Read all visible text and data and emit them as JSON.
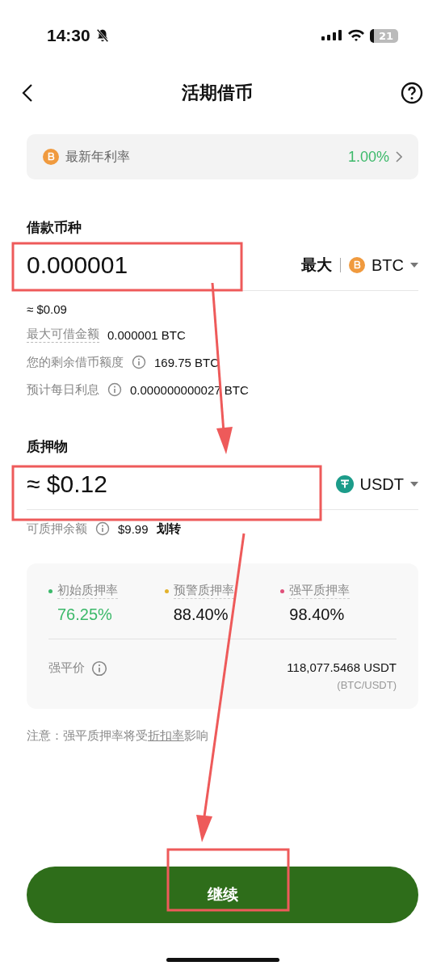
{
  "status_bar": {
    "time": "14:30",
    "battery": "21"
  },
  "header": {
    "title": "活期借币"
  },
  "rate_card": {
    "label": "最新年利率",
    "value": "1.00%"
  },
  "borrow": {
    "label": "借款币种",
    "amount": "0.000001",
    "max": "最大",
    "coin": "BTC",
    "approx": "≈ $0.09",
    "info": [
      {
        "label": "最大可借金额",
        "info_icon": false,
        "value": "0.000001 BTC"
      },
      {
        "label": "您的剩余借币额度",
        "info_icon": true,
        "value": "169.75 BTC"
      },
      {
        "label": "预计每日利息",
        "info_icon": true,
        "value": "0.000000000027 BTC"
      }
    ]
  },
  "collateral": {
    "label": "质押物",
    "amount": "≈ $0.12",
    "coin": "USDT",
    "balance_label": "可质押余额",
    "balance": "$9.99",
    "transfer": "划转"
  },
  "ratios": [
    {
      "label": "初始质押率",
      "value": "76.25%",
      "color": "#3cb96a",
      "highlight": true
    },
    {
      "label": "预警质押率",
      "value": "88.40%",
      "color": "#e3b22c",
      "highlight": false
    },
    {
      "label": "强平质押率",
      "value": "98.40%",
      "color": "#e0507a",
      "highlight": false
    }
  ],
  "liquidation": {
    "label": "强平价",
    "value": "118,077.5468 USDT",
    "pair": "(BTC/USDT)"
  },
  "note": {
    "prefix": "注意：强平质押率将受",
    "link": "折扣率",
    "suffix": "影响"
  },
  "continue_button": "继续"
}
